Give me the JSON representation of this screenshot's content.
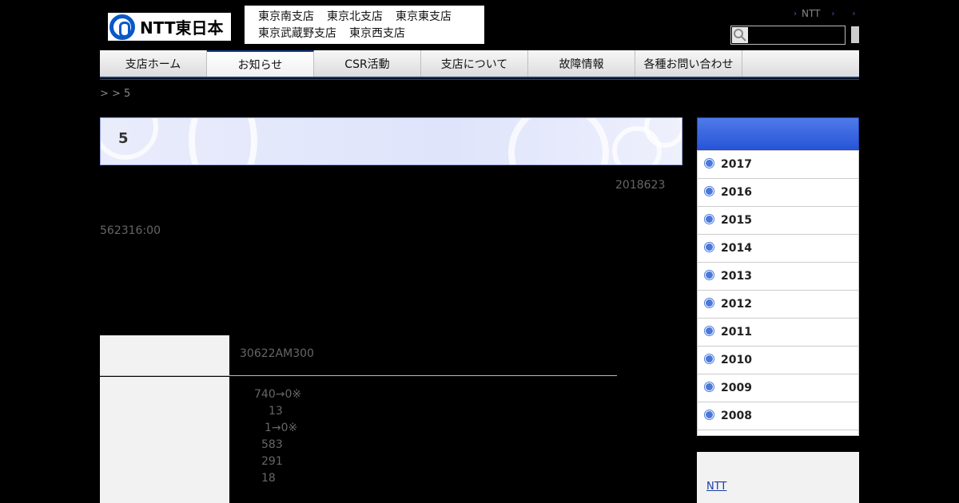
{
  "header": {
    "logo_text": "NTT東日本",
    "branches_row1": [
      "東京南支店",
      "東京北支店",
      "東京東支店"
    ],
    "branches_row2": [
      "東京武蔵野支店",
      "東京西支店"
    ],
    "top_link": "NTT",
    "search": {
      "placeholder": ""
    }
  },
  "nav": {
    "items": [
      "支店ホーム",
      "お知らせ",
      "CSR活動",
      "支店について",
      "故障情報",
      "各種お問い合わせ"
    ],
    "active_index": 1
  },
  "breadcrumb": " > > 5",
  "article": {
    "title": "5",
    "date": "2018623",
    "time_info": "562316:00",
    "table": {
      "row1_value": "30622AM300",
      "row2_lines": [
        "740→0※",
        "13",
        "1→0※",
        "583",
        "291",
        "18"
      ]
    }
  },
  "sidebar": {
    "years": [
      "2017",
      "2016",
      "2015",
      "2014",
      "2013",
      "2012",
      "2011",
      "2010",
      "2009",
      "2008"
    ],
    "link": "NTT"
  },
  "colors": {
    "accent": "#2855d8",
    "nav_border": "#0e3b8c",
    "background": "#000000"
  }
}
